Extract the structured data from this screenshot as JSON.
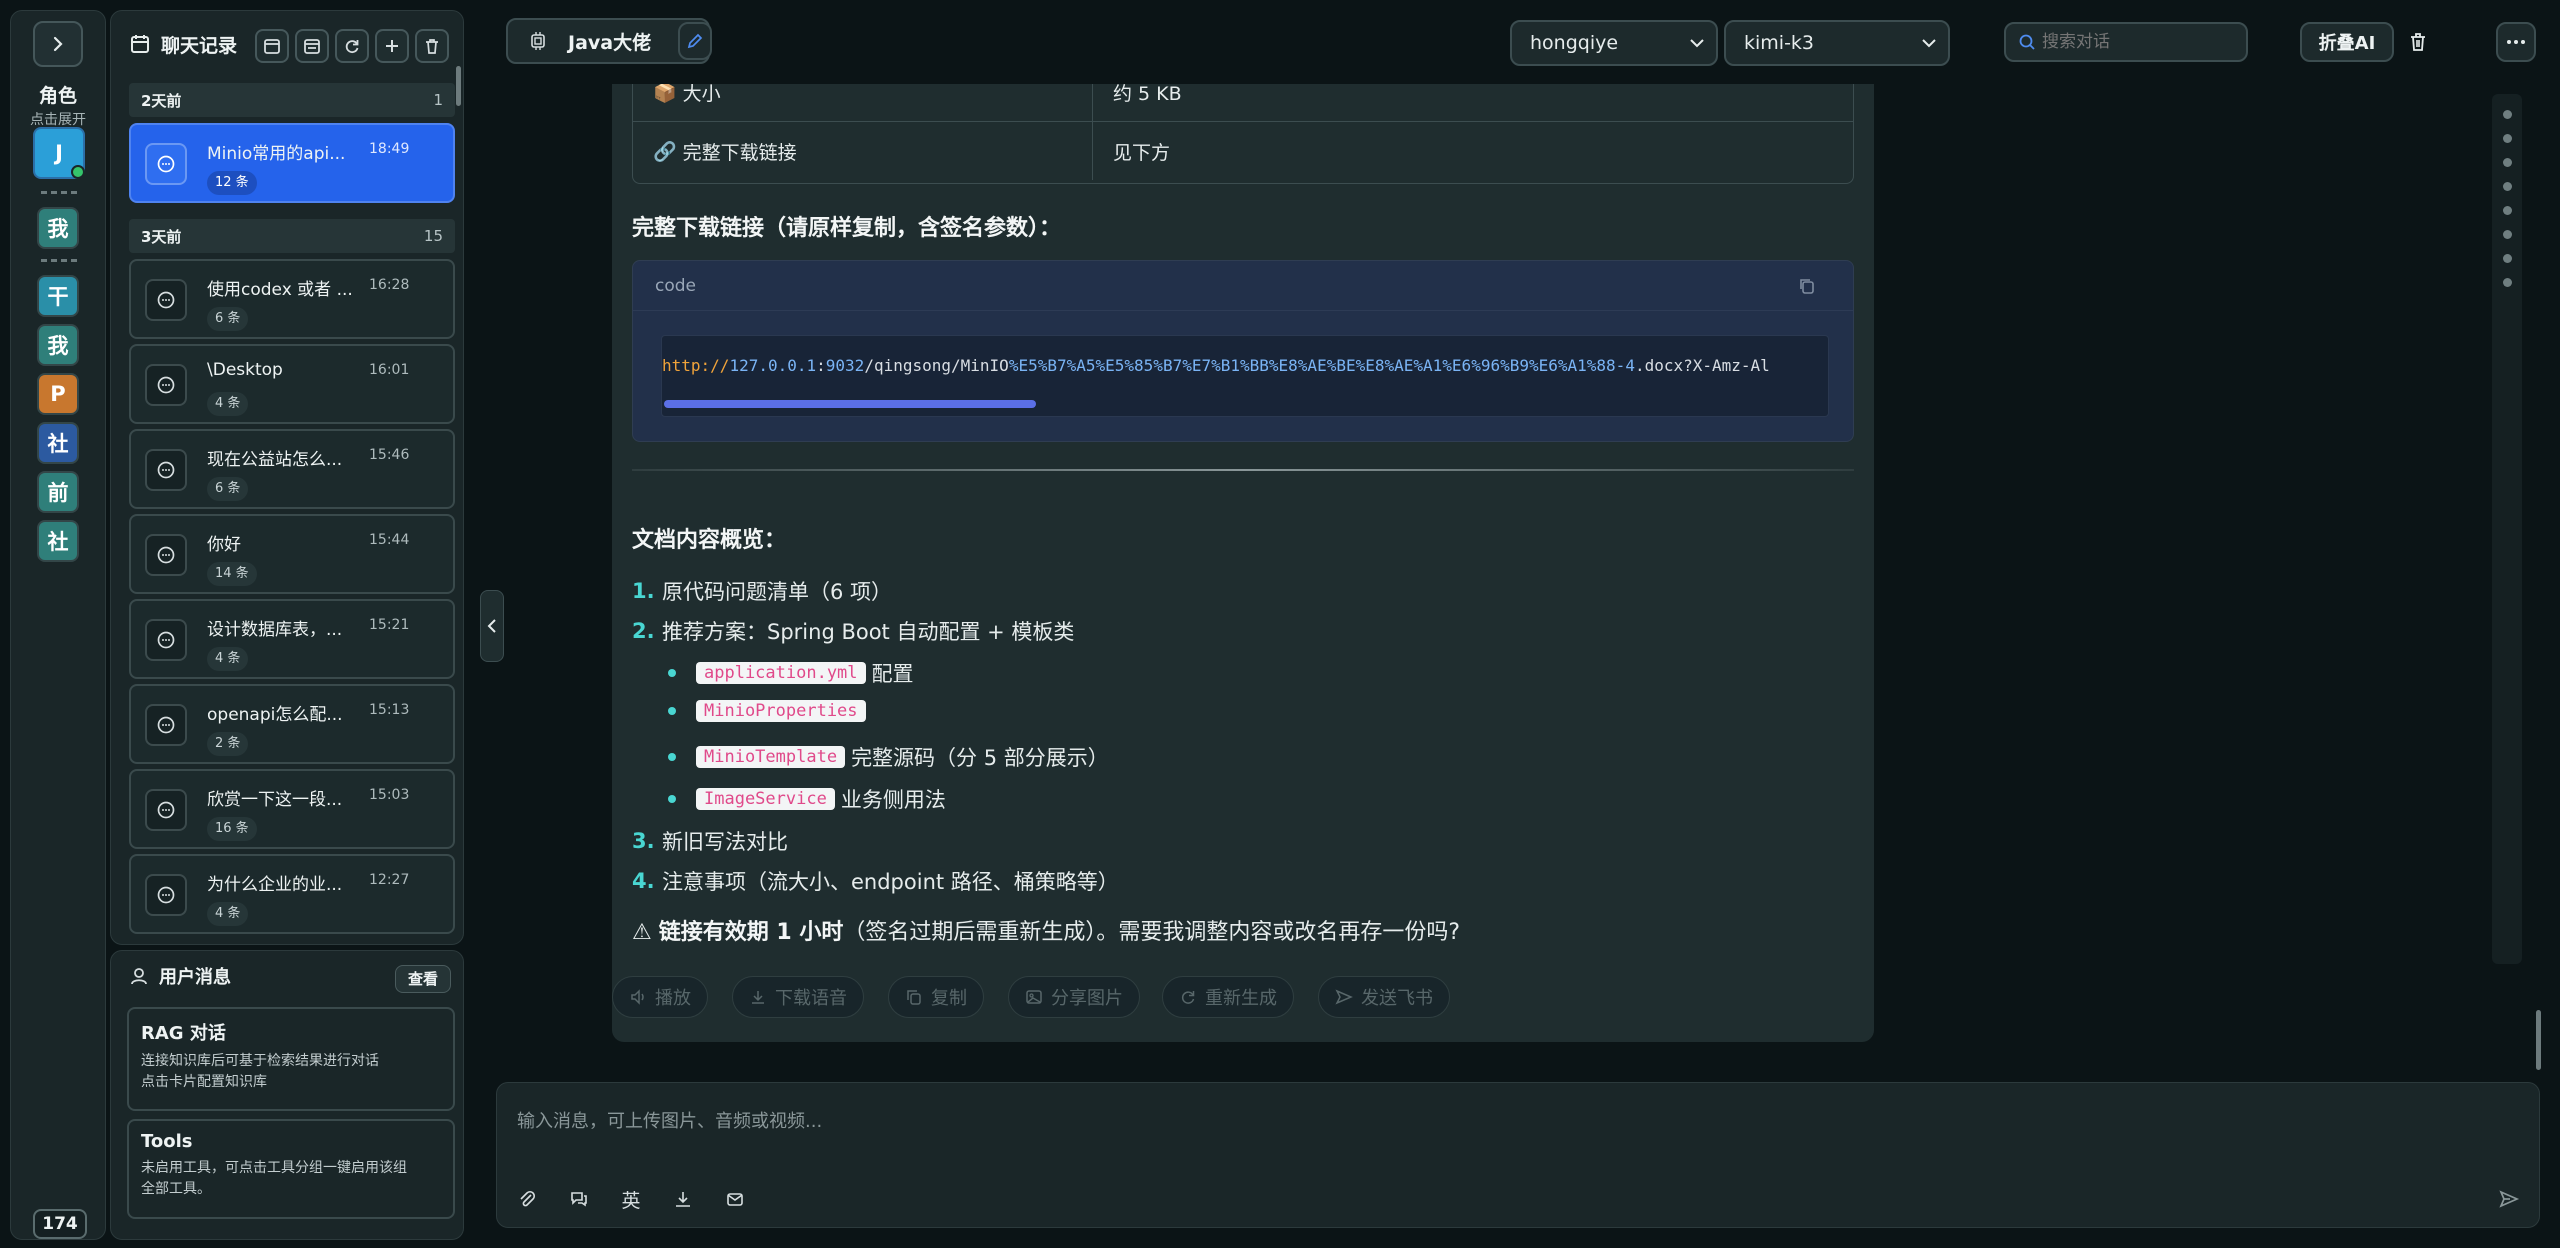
{
  "rail": {
    "title": "角色",
    "subtitle": "点击展开",
    "avatars": [
      {
        "label": "J",
        "color": "#2b9fd8"
      },
      {
        "label": "我",
        "color": "#2f7f7a"
      },
      {
        "label": "干",
        "color": "#2a8fa8"
      },
      {
        "label": "我",
        "color": "#2f7f7a"
      },
      {
        "label": "P",
        "color": "#c8772e"
      },
      {
        "label": "社",
        "color": "#2c5aa0"
      },
      {
        "label": "前",
        "color": "#2f7f7a"
      },
      {
        "label": "社",
        "color": "#2f7f7a"
      }
    ],
    "count": "174"
  },
  "chat_panel": {
    "title": "聊天记录",
    "groups": [
      {
        "label": "2天前",
        "count": "1"
      },
      {
        "label": "3天前",
        "count": "15"
      }
    ],
    "conversations": [
      {
        "title": "Minio常用的api...",
        "time": "18:49",
        "badge": "12 条",
        "active": true
      },
      {
        "title": "使用codex 或者 ...",
        "time": "16:28",
        "badge": "6 条"
      },
      {
        "title": "\\Desktop",
        "time": "16:01",
        "badge": "4 条"
      },
      {
        "title": "现在公益站怎么...",
        "time": "15:46",
        "badge": "6 条"
      },
      {
        "title": "你好",
        "time": "15:44",
        "badge": "14 条"
      },
      {
        "title": "设计数据库表，...",
        "time": "15:21",
        "badge": "4 条"
      },
      {
        "title": "openapi怎么配...",
        "time": "15:13",
        "badge": "2 条"
      },
      {
        "title": "欣赏一下这一段...",
        "time": "15:03",
        "badge": "16 条"
      },
      {
        "title": "为什么企业的业...",
        "time": "12:27",
        "badge": "4 条"
      }
    ]
  },
  "user_panel": {
    "title": "用户消息",
    "view_label": "查看",
    "cards": [
      {
        "title": "RAG 对话",
        "line1": "连接知识库后可基于检索结果进行对话",
        "line2": "点击卡片配置知识库"
      },
      {
        "title": "Tools",
        "line1": "未启用工具，可点击工具分组一键启用该组",
        "line2": "全部工具。"
      }
    ]
  },
  "topbar": {
    "chat_name": "Java大佬",
    "provider": "hongqiye",
    "model": "kimi-k3",
    "search_placeholder": "搜索对话",
    "fold_label": "折叠AI"
  },
  "message": {
    "table": [
      {
        "icon": "📦",
        "key": "大小",
        "value": "约 5 KB"
      },
      {
        "icon": "🔗",
        "key": "完整下载链接",
        "value": "见下方"
      }
    ],
    "link_heading": "完整下载链接（请原样复制，含签名参数）：",
    "code_lang": "code",
    "code": {
      "scheme": "http://",
      "host": "127.0.0.1",
      "colon": ":",
      "port": "9032",
      "path": "/qingsong/MinIO",
      "encoded": "%E5%B7%A5%E5%85%B7%E7%B1%BB%E8%AE%BE%E8%AE%A1%E6%96%B9%E6%A1%88-4",
      "tail": ".docx?X-Amz-Al"
    },
    "overview_heading": "文档内容概览：",
    "ol": [
      {
        "num": "1.",
        "text": "原代码问题清单（6 项）"
      },
      {
        "num": "2.",
        "text": "推荐方案：Spring Boot 自动配置 + 模板类"
      },
      {
        "num": "3.",
        "text": "新旧写法对比"
      },
      {
        "num": "4.",
        "text": "注意事项（流大小、endpoint 路径、桶策略等）"
      }
    ],
    "ul": [
      {
        "chip": "application.yml",
        "text": "配置"
      },
      {
        "chip": "MinioProperties",
        "text": ""
      },
      {
        "chip": "MinioTemplate",
        "text": "完整源码（分 5 部分展示）"
      },
      {
        "chip": "ImageService",
        "text": "业务侧用法"
      }
    ],
    "warn_icon": "⚠",
    "warn_bold": "链接有效期 1 小时",
    "warn_text": "（签名过期后需重新生成）。需要我调整内容或改名再存一份吗?"
  },
  "actions": [
    "播放",
    "下载语音",
    "复制",
    "分享图片",
    "重新生成",
    "发送飞书"
  ],
  "composer": {
    "placeholder": "输入消息，可上传图片、音频或视频...",
    "lang_label": "英"
  }
}
